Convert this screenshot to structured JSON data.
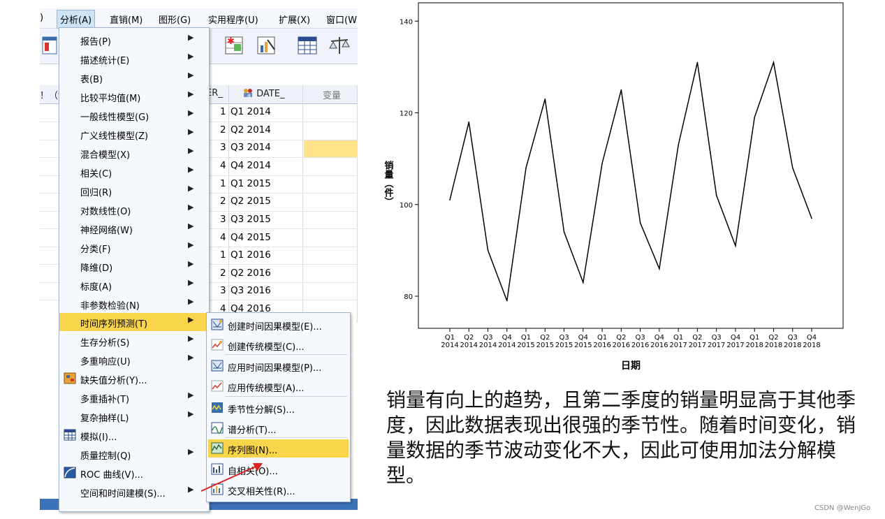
{
  "menubar": {
    "items": [
      {
        "label": ")"
      },
      {
        "label": "分析(A)"
      },
      {
        "label": "直销(M)"
      },
      {
        "label": "图形(G)"
      },
      {
        "label": "实用程序(U)"
      },
      {
        "label": "扩展(X)"
      },
      {
        "label": "窗口(W"
      }
    ]
  },
  "grid": {
    "left_header": "！（f",
    "header_er": "ER_",
    "header_date": "DATE_",
    "header_var": "变量",
    "rows": [
      {
        "n": "1",
        "date": "Q1 2014"
      },
      {
        "n": "2",
        "date": "Q2 2014"
      },
      {
        "n": "3",
        "date": "Q3 2014"
      },
      {
        "n": "4",
        "date": "Q4 2014"
      },
      {
        "n": "1",
        "date": "Q1 2015"
      },
      {
        "n": "2",
        "date": "Q2 2015"
      },
      {
        "n": "3",
        "date": "Q3 2015"
      },
      {
        "n": "4",
        "date": "Q4 2015"
      },
      {
        "n": "1",
        "date": "Q1 2016"
      },
      {
        "n": "2",
        "date": "Q2 2016"
      },
      {
        "n": "3",
        "date": "Q3 2016"
      },
      {
        "n": "4",
        "date": "Q4 2016"
      }
    ]
  },
  "analyze_menu": {
    "items": [
      {
        "label": "报告(P)",
        "submenu": true
      },
      {
        "label": "描述统计(E)",
        "submenu": true
      },
      {
        "label": "表(B)",
        "submenu": true
      },
      {
        "label": "比较平均值(M)",
        "submenu": true
      },
      {
        "label": "一般线性模型(G)",
        "submenu": true
      },
      {
        "label": "广义线性模型(Z)",
        "submenu": true
      },
      {
        "label": "混合模型(X)",
        "submenu": true
      },
      {
        "label": "相关(C)",
        "submenu": true
      },
      {
        "label": "回归(R)",
        "submenu": true
      },
      {
        "label": "对数线性(O)",
        "submenu": true
      },
      {
        "label": "神经网络(W)",
        "submenu": true
      },
      {
        "label": "分类(F)",
        "submenu": true
      },
      {
        "label": "降维(D)",
        "submenu": true
      },
      {
        "label": "标度(A)",
        "submenu": true
      },
      {
        "label": "非参数检验(N)",
        "submenu": true
      },
      {
        "label": "时间序列预测(T)",
        "submenu": true,
        "highlighted": true
      },
      {
        "label": "生存分析(S)",
        "submenu": true
      },
      {
        "label": "多重响应(U)",
        "submenu": true
      },
      {
        "label": "缺失值分析(Y)...",
        "submenu": false,
        "icon": "missing-values-icon"
      },
      {
        "label": "多重插补(T)",
        "submenu": true
      },
      {
        "label": "复杂抽样(L)",
        "submenu": true
      },
      {
        "label": "模拟(I)...",
        "submenu": false,
        "icon": "simulation-icon"
      },
      {
        "label": "质量控制(Q)",
        "submenu": true
      },
      {
        "label": "ROC 曲线(V)...",
        "submenu": false,
        "icon": "roc-curve-icon"
      },
      {
        "label": "空间和时间建模(S)...",
        "submenu": true
      }
    ]
  },
  "timeseries_menu": {
    "items": [
      {
        "label": "创建时间因果模型(E)...",
        "icon": "causal-model-icon"
      },
      {
        "label": "创建传统模型(C)...",
        "icon": "traditional-model-icon"
      },
      {
        "label": "应用时间因果模型(P)...",
        "icon": "apply-causal-icon"
      },
      {
        "label": "应用传统模型(A)...",
        "icon": "apply-traditional-icon"
      },
      {
        "label": "季节性分解(S)...",
        "icon": "seasonal-decomposition-icon"
      },
      {
        "label": "谱分析(T)...",
        "icon": "spectral-analysis-icon"
      },
      {
        "label": "序列图(N)...",
        "icon": "sequence-chart-icon",
        "highlighted": true
      },
      {
        "label": "自相关(O)...",
        "icon": "autocorrelation-icon"
      },
      {
        "label": "交叉相关性(R)...",
        "icon": "cross-correlation-icon"
      }
    ]
  },
  "chart_data": {
    "type": "line",
    "xlabel": "日期",
    "ylabel": "销量（件）",
    "ylim": [
      73,
      144
    ],
    "yticks": [
      80,
      100,
      120,
      140
    ],
    "categories": [
      [
        "Q1",
        "2014"
      ],
      [
        "Q2",
        "2014"
      ],
      [
        "Q3",
        "2014"
      ],
      [
        "Q4",
        "2014"
      ],
      [
        "Q1",
        "2015"
      ],
      [
        "Q2",
        "2015"
      ],
      [
        "Q3",
        "2015"
      ],
      [
        "Q4",
        "2015"
      ],
      [
        "Q1",
        "2016"
      ],
      [
        "Q2",
        "2016"
      ],
      [
        "Q3",
        "2016"
      ],
      [
        "Q4",
        "2016"
      ],
      [
        "Q1",
        "2017"
      ],
      [
        "Q2",
        "2017"
      ],
      [
        "Q3",
        "2017"
      ],
      [
        "Q4",
        "2017"
      ],
      [
        "Q1",
        "2018"
      ],
      [
        "Q2",
        "2018"
      ],
      [
        "Q3",
        "2018"
      ],
      [
        "Q4",
        "2018"
      ]
    ],
    "values": [
      101,
      118,
      90,
      79,
      108,
      123,
      94,
      83,
      109,
      125,
      96,
      86,
      113,
      131,
      102,
      91,
      119,
      131,
      108,
      97
    ],
    "line_color": "#000000"
  },
  "caption": {
    "text": "销量有向上的趋势，且第二季度的销量明显高于其他季度，因此数据表现出很强的季节性。随着时间变化，销量数据的季节波动变化不大，因此可使用加法分解模型。"
  },
  "credit": "CSDN @WenJGo",
  "colors": {
    "highlight": "#f8d54a",
    "menu_bg": "#f5f8fc",
    "selected_cell": "#ffe38a"
  }
}
